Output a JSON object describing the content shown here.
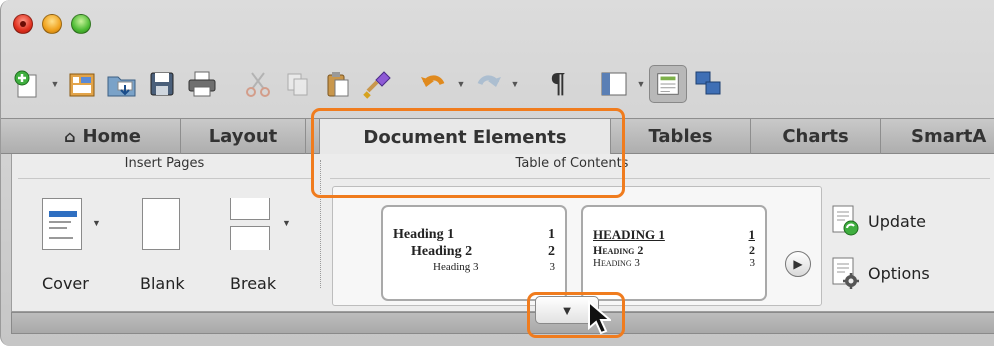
{
  "window": {
    "traffic_lights": [
      "close",
      "minimize",
      "zoom"
    ]
  },
  "toolbar": {
    "icons": [
      "new-document-icon",
      "templates-gallery-icon",
      "open-icon",
      "save-icon",
      "print-icon",
      "cut-icon",
      "copy-icon",
      "paste-icon",
      "format-painter-icon",
      "undo-icon",
      "redo-icon",
      "pilcrow-icon",
      "sidebar-icon",
      "view-icon",
      "media-browser-icon"
    ],
    "pilcrow": "¶"
  },
  "tabs": [
    {
      "label": "Home",
      "icon": "home-icon"
    },
    {
      "label": "Layout"
    },
    {
      "label": "Document Elements",
      "active": true
    },
    {
      "label": "Tables"
    },
    {
      "label": "Charts"
    },
    {
      "label": "SmartA"
    }
  ],
  "ribbon": {
    "insert_pages": {
      "title": "Insert Pages",
      "buttons": [
        {
          "label": "Cover",
          "icon": "cover-page-icon"
        },
        {
          "label": "Blank",
          "icon": "blank-page-icon"
        },
        {
          "label": "Break",
          "icon": "page-break-icon"
        }
      ]
    },
    "toc": {
      "title": "Table of Contents",
      "style_a": {
        "h1": "Heading 1",
        "h1_page": "1",
        "h2": "Heading 2",
        "h2_page": "2",
        "h3": "Heading 3",
        "h3_page": "3"
      },
      "style_b": {
        "h1": "HEADING 1",
        "h1_page": "1",
        "h2": "Heading 2",
        "h2_page": "2",
        "h3": "Heading 3",
        "h3_page": "3"
      },
      "update_label": "Update",
      "options_label": "Options"
    }
  },
  "highlight_color": "#f07c1e"
}
